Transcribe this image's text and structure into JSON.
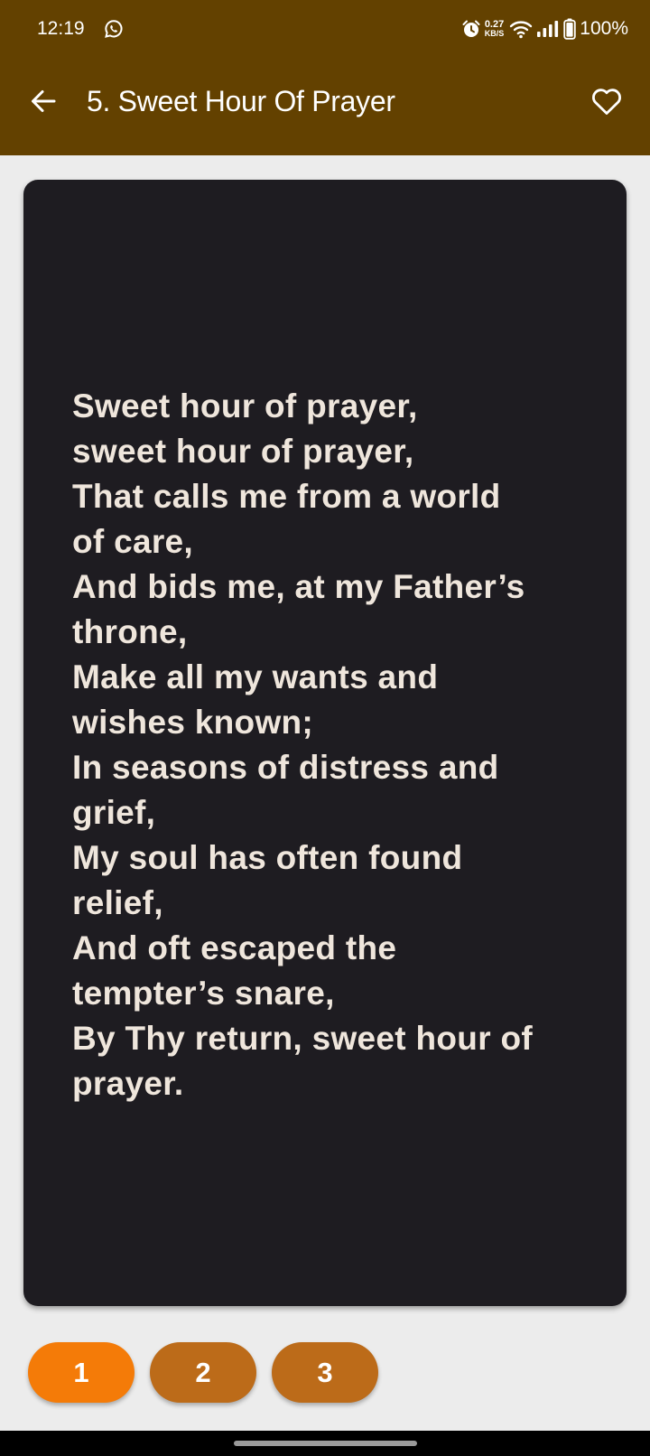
{
  "status_bar": {
    "time": "12:19",
    "net_speed_value": "0.27",
    "net_speed_unit": "KB/S",
    "battery": "100%",
    "icons": [
      "whatsapp-icon",
      "alarm-icon",
      "wifi-icon",
      "signal-icon",
      "battery-icon"
    ]
  },
  "app_bar": {
    "title": "5. Sweet Hour Of Prayer",
    "back_icon": "arrow-left-icon",
    "favorite_icon": "heart-outline-icon"
  },
  "lyrics": {
    "text": "Sweet hour of prayer,\nsweet hour of prayer,\nThat calls me from a world\nof care,\nAnd bids me, at my Father’s\nthrone,\nMake all my wants and\nwishes known;\nIn seasons of distress and\ngrief,\nMy soul has often found\nrelief,\nAnd oft escaped the\ntempter’s snare,\nBy Thy return, sweet hour of\nprayer."
  },
  "verses": [
    {
      "label": "1",
      "selected": true
    },
    {
      "label": "2",
      "selected": false
    },
    {
      "label": "3",
      "selected": false
    }
  ],
  "colors": {
    "app_bar": "#634100",
    "card": "#1e1c21",
    "lyrics_text": "#efe6dc",
    "verse_selected": "#f47b08",
    "verse_default": "#bc6b19",
    "background": "#ececec"
  }
}
